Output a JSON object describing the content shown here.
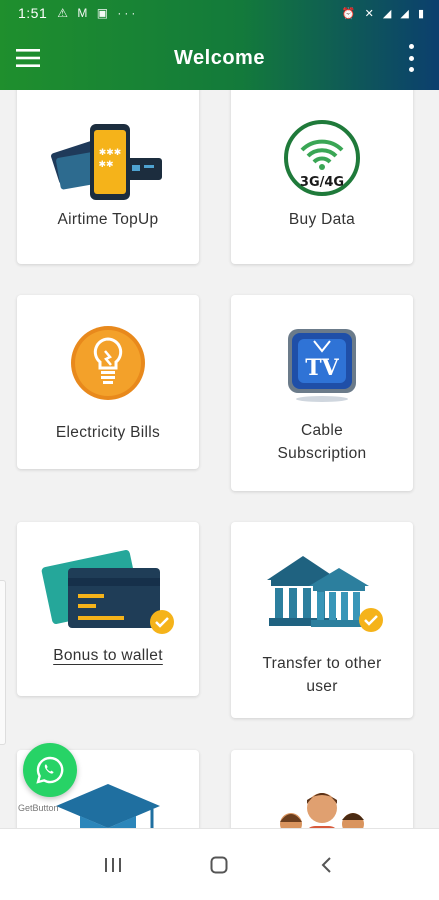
{
  "status_bar": {
    "time": "1:51",
    "left_icons": [
      "signal-alert-icon",
      "gmail-icon",
      "image-icon",
      "more-dots-icon"
    ],
    "right_icons": [
      "alarm-icon",
      "mute-icon",
      "4g-signal-icon",
      "3g-signal-icon",
      "battery-icon"
    ]
  },
  "app_bar": {
    "title": "Welcome",
    "menu_icon": "hamburger-menu-icon",
    "more_icon": "overflow-menu-icon",
    "gradient_colors": [
      "#1f8f2d",
      "#137a3b",
      "#0b3f6e"
    ]
  },
  "services": [
    {
      "id": "airtime",
      "label": "Airtime TopUp",
      "icon": "phone-cards-icon"
    },
    {
      "id": "data",
      "label": "Buy Data",
      "icon": "3g-4g-wifi-icon",
      "icon_text": "3G/4G"
    },
    {
      "id": "electricity",
      "label": "Electricity Bills",
      "icon": "lightbulb-icon"
    },
    {
      "id": "cable",
      "label_line1": "Cable",
      "label_line2": "Subscription",
      "icon": "tv-icon",
      "icon_text": "TV"
    },
    {
      "id": "bonus",
      "label": "Bonus to wallet",
      "icon": "cards-check-icon"
    },
    {
      "id": "transfer",
      "label_line1": "Transfer to other",
      "label_line2": "user",
      "icon": "bank-check-icon"
    },
    {
      "id": "education",
      "label": "",
      "icon": "graduation-cap-icon"
    },
    {
      "id": "users",
      "label": "",
      "icon": "people-icon"
    }
  ],
  "floating": {
    "whatsapp_icon": "whatsapp-icon",
    "getbutton_label": "GetButton"
  },
  "nav_bar": {
    "recents_icon": "recents-icon",
    "home_icon": "home-icon",
    "back_icon": "back-icon"
  }
}
